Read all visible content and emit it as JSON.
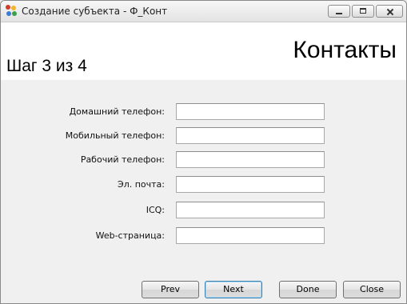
{
  "window": {
    "title": "Создание субъекта - Ф_Конт"
  },
  "header": {
    "step": "Шаг 3 из 4",
    "heading": "Контакты"
  },
  "form": {
    "fields": [
      {
        "label": "Домашний телефон:",
        "value": ""
      },
      {
        "label": "Мобильный телефон:",
        "value": ""
      },
      {
        "label": "Рабочий телефон:",
        "value": ""
      },
      {
        "label": "Эл. почта:",
        "value": ""
      },
      {
        "label": "ICQ:",
        "value": ""
      },
      {
        "label": "Web-страница:",
        "value": ""
      }
    ]
  },
  "buttons": {
    "prev": "Prev",
    "next": "Next",
    "done": "Done",
    "close": "Close"
  },
  "icons": {
    "app": "app-icon",
    "minimize": "minimize-icon",
    "maximize": "maximize-icon",
    "close": "close-icon"
  }
}
